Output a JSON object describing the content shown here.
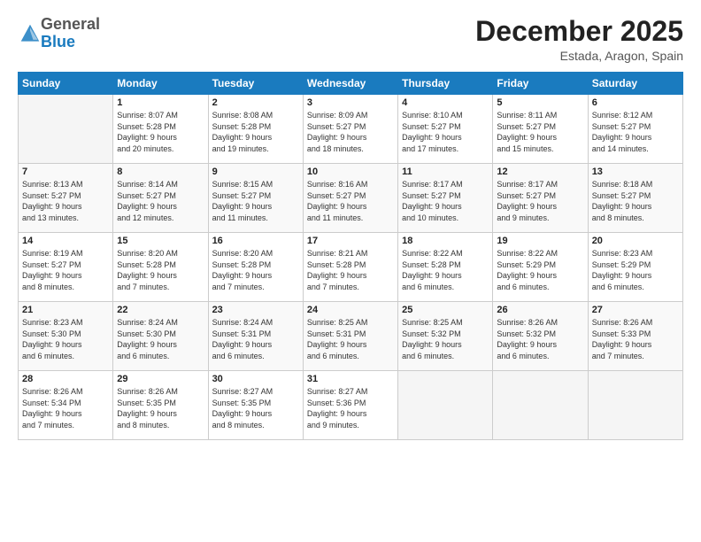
{
  "logo": {
    "general": "General",
    "blue": "Blue"
  },
  "header": {
    "month": "December 2025",
    "location": "Estada, Aragon, Spain"
  },
  "weekdays": [
    "Sunday",
    "Monday",
    "Tuesday",
    "Wednesday",
    "Thursday",
    "Friday",
    "Saturday"
  ],
  "weeks": [
    [
      {
        "day": "",
        "info": ""
      },
      {
        "day": "1",
        "info": "Sunrise: 8:07 AM\nSunset: 5:28 PM\nDaylight: 9 hours\nand 20 minutes."
      },
      {
        "day": "2",
        "info": "Sunrise: 8:08 AM\nSunset: 5:28 PM\nDaylight: 9 hours\nand 19 minutes."
      },
      {
        "day": "3",
        "info": "Sunrise: 8:09 AM\nSunset: 5:27 PM\nDaylight: 9 hours\nand 18 minutes."
      },
      {
        "day": "4",
        "info": "Sunrise: 8:10 AM\nSunset: 5:27 PM\nDaylight: 9 hours\nand 17 minutes."
      },
      {
        "day": "5",
        "info": "Sunrise: 8:11 AM\nSunset: 5:27 PM\nDaylight: 9 hours\nand 15 minutes."
      },
      {
        "day": "6",
        "info": "Sunrise: 8:12 AM\nSunset: 5:27 PM\nDaylight: 9 hours\nand 14 minutes."
      }
    ],
    [
      {
        "day": "7",
        "info": "Sunrise: 8:13 AM\nSunset: 5:27 PM\nDaylight: 9 hours\nand 13 minutes."
      },
      {
        "day": "8",
        "info": "Sunrise: 8:14 AM\nSunset: 5:27 PM\nDaylight: 9 hours\nand 12 minutes."
      },
      {
        "day": "9",
        "info": "Sunrise: 8:15 AM\nSunset: 5:27 PM\nDaylight: 9 hours\nand 11 minutes."
      },
      {
        "day": "10",
        "info": "Sunrise: 8:16 AM\nSunset: 5:27 PM\nDaylight: 9 hours\nand 11 minutes."
      },
      {
        "day": "11",
        "info": "Sunrise: 8:17 AM\nSunset: 5:27 PM\nDaylight: 9 hours\nand 10 minutes."
      },
      {
        "day": "12",
        "info": "Sunrise: 8:17 AM\nSunset: 5:27 PM\nDaylight: 9 hours\nand 9 minutes."
      },
      {
        "day": "13",
        "info": "Sunrise: 8:18 AM\nSunset: 5:27 PM\nDaylight: 9 hours\nand 8 minutes."
      }
    ],
    [
      {
        "day": "14",
        "info": "Sunrise: 8:19 AM\nSunset: 5:27 PM\nDaylight: 9 hours\nand 8 minutes."
      },
      {
        "day": "15",
        "info": "Sunrise: 8:20 AM\nSunset: 5:28 PM\nDaylight: 9 hours\nand 7 minutes."
      },
      {
        "day": "16",
        "info": "Sunrise: 8:20 AM\nSunset: 5:28 PM\nDaylight: 9 hours\nand 7 minutes."
      },
      {
        "day": "17",
        "info": "Sunrise: 8:21 AM\nSunset: 5:28 PM\nDaylight: 9 hours\nand 7 minutes."
      },
      {
        "day": "18",
        "info": "Sunrise: 8:22 AM\nSunset: 5:28 PM\nDaylight: 9 hours\nand 6 minutes."
      },
      {
        "day": "19",
        "info": "Sunrise: 8:22 AM\nSunset: 5:29 PM\nDaylight: 9 hours\nand 6 minutes."
      },
      {
        "day": "20",
        "info": "Sunrise: 8:23 AM\nSunset: 5:29 PM\nDaylight: 9 hours\nand 6 minutes."
      }
    ],
    [
      {
        "day": "21",
        "info": "Sunrise: 8:23 AM\nSunset: 5:30 PM\nDaylight: 9 hours\nand 6 minutes."
      },
      {
        "day": "22",
        "info": "Sunrise: 8:24 AM\nSunset: 5:30 PM\nDaylight: 9 hours\nand 6 minutes."
      },
      {
        "day": "23",
        "info": "Sunrise: 8:24 AM\nSunset: 5:31 PM\nDaylight: 9 hours\nand 6 minutes."
      },
      {
        "day": "24",
        "info": "Sunrise: 8:25 AM\nSunset: 5:31 PM\nDaylight: 9 hours\nand 6 minutes."
      },
      {
        "day": "25",
        "info": "Sunrise: 8:25 AM\nSunset: 5:32 PM\nDaylight: 9 hours\nand 6 minutes."
      },
      {
        "day": "26",
        "info": "Sunrise: 8:26 AM\nSunset: 5:32 PM\nDaylight: 9 hours\nand 6 minutes."
      },
      {
        "day": "27",
        "info": "Sunrise: 8:26 AM\nSunset: 5:33 PM\nDaylight: 9 hours\nand 7 minutes."
      }
    ],
    [
      {
        "day": "28",
        "info": "Sunrise: 8:26 AM\nSunset: 5:34 PM\nDaylight: 9 hours\nand 7 minutes."
      },
      {
        "day": "29",
        "info": "Sunrise: 8:26 AM\nSunset: 5:35 PM\nDaylight: 9 hours\nand 8 minutes."
      },
      {
        "day": "30",
        "info": "Sunrise: 8:27 AM\nSunset: 5:35 PM\nDaylight: 9 hours\nand 8 minutes."
      },
      {
        "day": "31",
        "info": "Sunrise: 8:27 AM\nSunset: 5:36 PM\nDaylight: 9 hours\nand 9 minutes."
      },
      {
        "day": "",
        "info": ""
      },
      {
        "day": "",
        "info": ""
      },
      {
        "day": "",
        "info": ""
      }
    ]
  ]
}
